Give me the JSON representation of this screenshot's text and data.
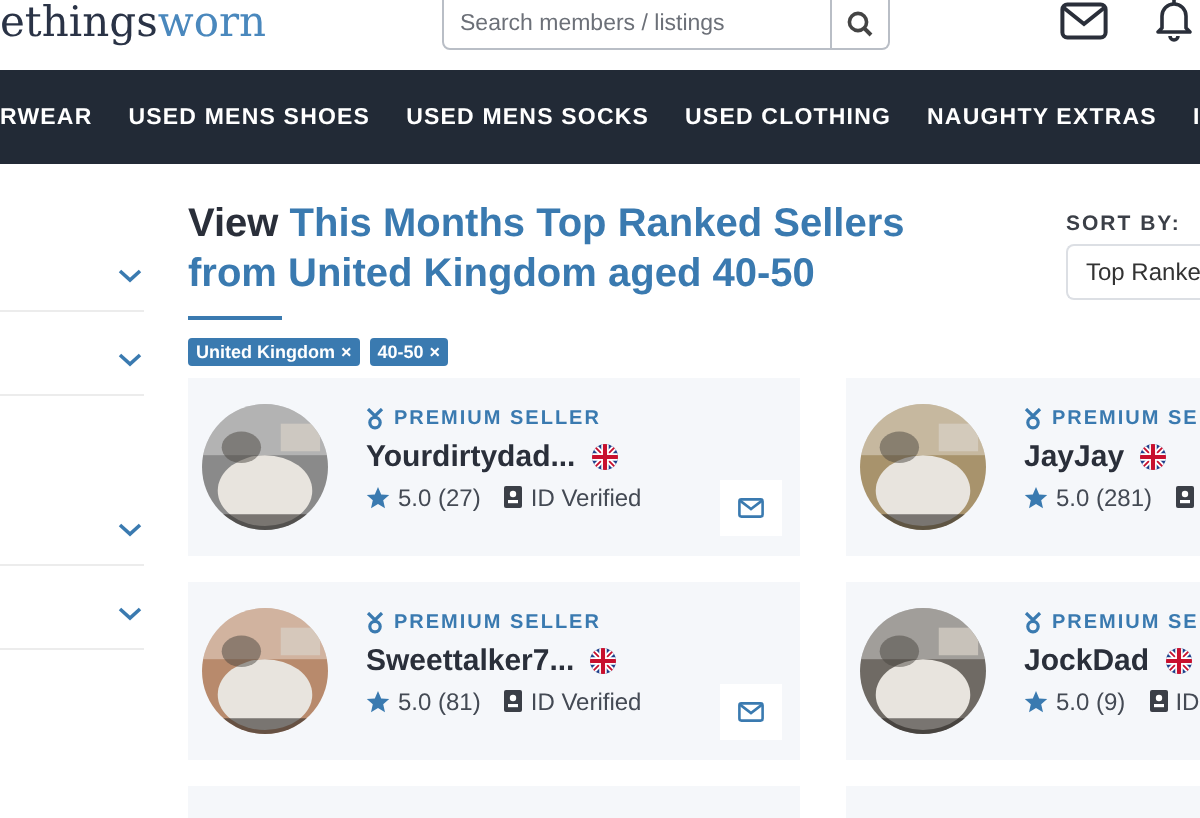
{
  "logo": {
    "prefix": "ethings",
    "suffix": "worn"
  },
  "search": {
    "placeholder": "Search members / listings"
  },
  "nav": [
    "RWEAR",
    "USED MENS SHOES",
    "USED MENS SOCKS",
    "USED CLOTHING",
    "NAUGHTY EXTRAS",
    "I"
  ],
  "filters": [
    {
      "kind": "dropdown",
      "expanded": false
    },
    {
      "kind": "dropdown",
      "expanded": false
    },
    {
      "kind": "spacer"
    },
    {
      "kind": "dropdown",
      "expanded": false
    },
    {
      "kind": "dropdown",
      "expanded": false
    }
  ],
  "heading": {
    "lead": "View",
    "title": "This Months Top Ranked Sellers from United Kingdom aged 40-50"
  },
  "sort": {
    "label": "SORT BY:",
    "value": "Top Ranke"
  },
  "tags": [
    {
      "label": "United Kingdom",
      "remove": "×"
    },
    {
      "label": "40-50",
      "remove": "×"
    }
  ],
  "sellers": [
    {
      "badge": "PREMIUM SELLER",
      "name": "Yourdirtydad...",
      "rating": "5.0",
      "count": "(27)",
      "verified": "ID Verified",
      "message_button": true
    },
    {
      "badge": "PREMIUM SE",
      "name": "JayJay",
      "rating": "5.0",
      "count": "(281)",
      "message_button": false
    },
    {
      "badge": "PREMIUM SELLER",
      "name": "Sweettalker7...",
      "rating": "5.0",
      "count": "(81)",
      "verified": "ID Verified",
      "message_button": true
    },
    {
      "badge": "PREMIUM SE",
      "name": "JockDad",
      "rating": "5.0",
      "count": "(9)",
      "verified": "ID",
      "message_button": false
    }
  ]
}
